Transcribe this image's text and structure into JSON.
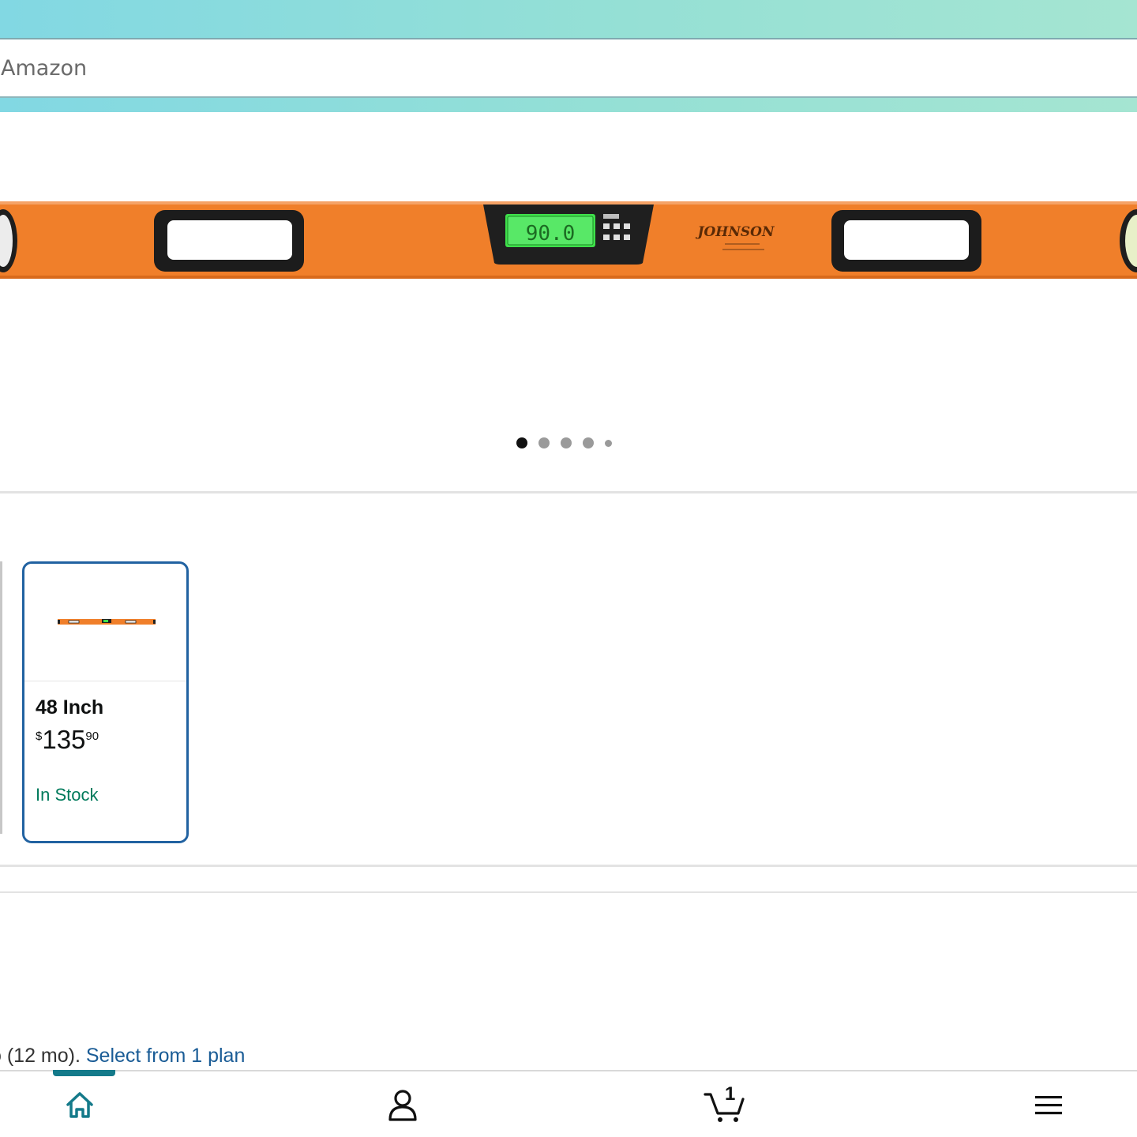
{
  "search": {
    "placeholder": "Amazon"
  },
  "gallery": {
    "image_alt": "Johnson digital level",
    "brand_mark": "JOHNSON",
    "display_reading": "90.0",
    "dots_total": 5,
    "active_dot": 1
  },
  "variants": [
    {
      "name": "48 Inch",
      "price_symbol": "$",
      "price_whole": "135",
      "price_fraction": "90",
      "stock": "In Stock",
      "selected": true
    }
  ],
  "protection_plan": {
    "prefix": "o (12 mo). ",
    "link": "Select from 1 plan"
  },
  "bottom_nav": {
    "items": [
      "home-icon",
      "account-icon",
      "cart-icon",
      "menu-icon"
    ],
    "cart_count": "1",
    "active": "home"
  },
  "colors": {
    "accent": "#2162a1",
    "link": "#1a5c96",
    "in_stock": "#007a5b",
    "level_orange": "#f07f2a",
    "lcd_green": "#3ee04a",
    "nav_active": "#147a8a"
  }
}
